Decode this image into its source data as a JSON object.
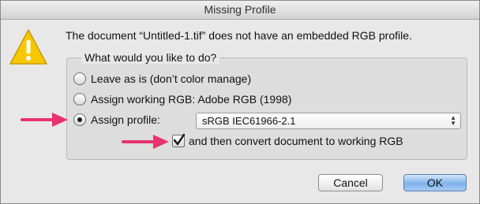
{
  "dialog": {
    "title": "Missing Profile",
    "message": "The document “Untitled-1.tif” does not have an embedded RGB profile.",
    "group_label": "What would you like to do?",
    "options": [
      {
        "label": "Leave as is (don’t color manage)",
        "selected": false
      },
      {
        "label": "Assign working RGB:  Adobe RGB (1998)",
        "selected": false
      },
      {
        "label": "Assign profile:",
        "selected": true
      }
    ],
    "profile_select": {
      "value": "sRGB IEC61966-2.1"
    },
    "convert_checkbox": {
      "label": "and then convert document to working RGB",
      "checked": true
    },
    "buttons": {
      "cancel": "Cancel",
      "ok": "OK"
    }
  },
  "colors": {
    "arrow": "#e8336d",
    "warning": "#f2c200",
    "default_button": "#7fb2ea"
  },
  "icons": {
    "warning": "warning-triangle-icon",
    "arrow": "pointer-arrow-icon"
  }
}
